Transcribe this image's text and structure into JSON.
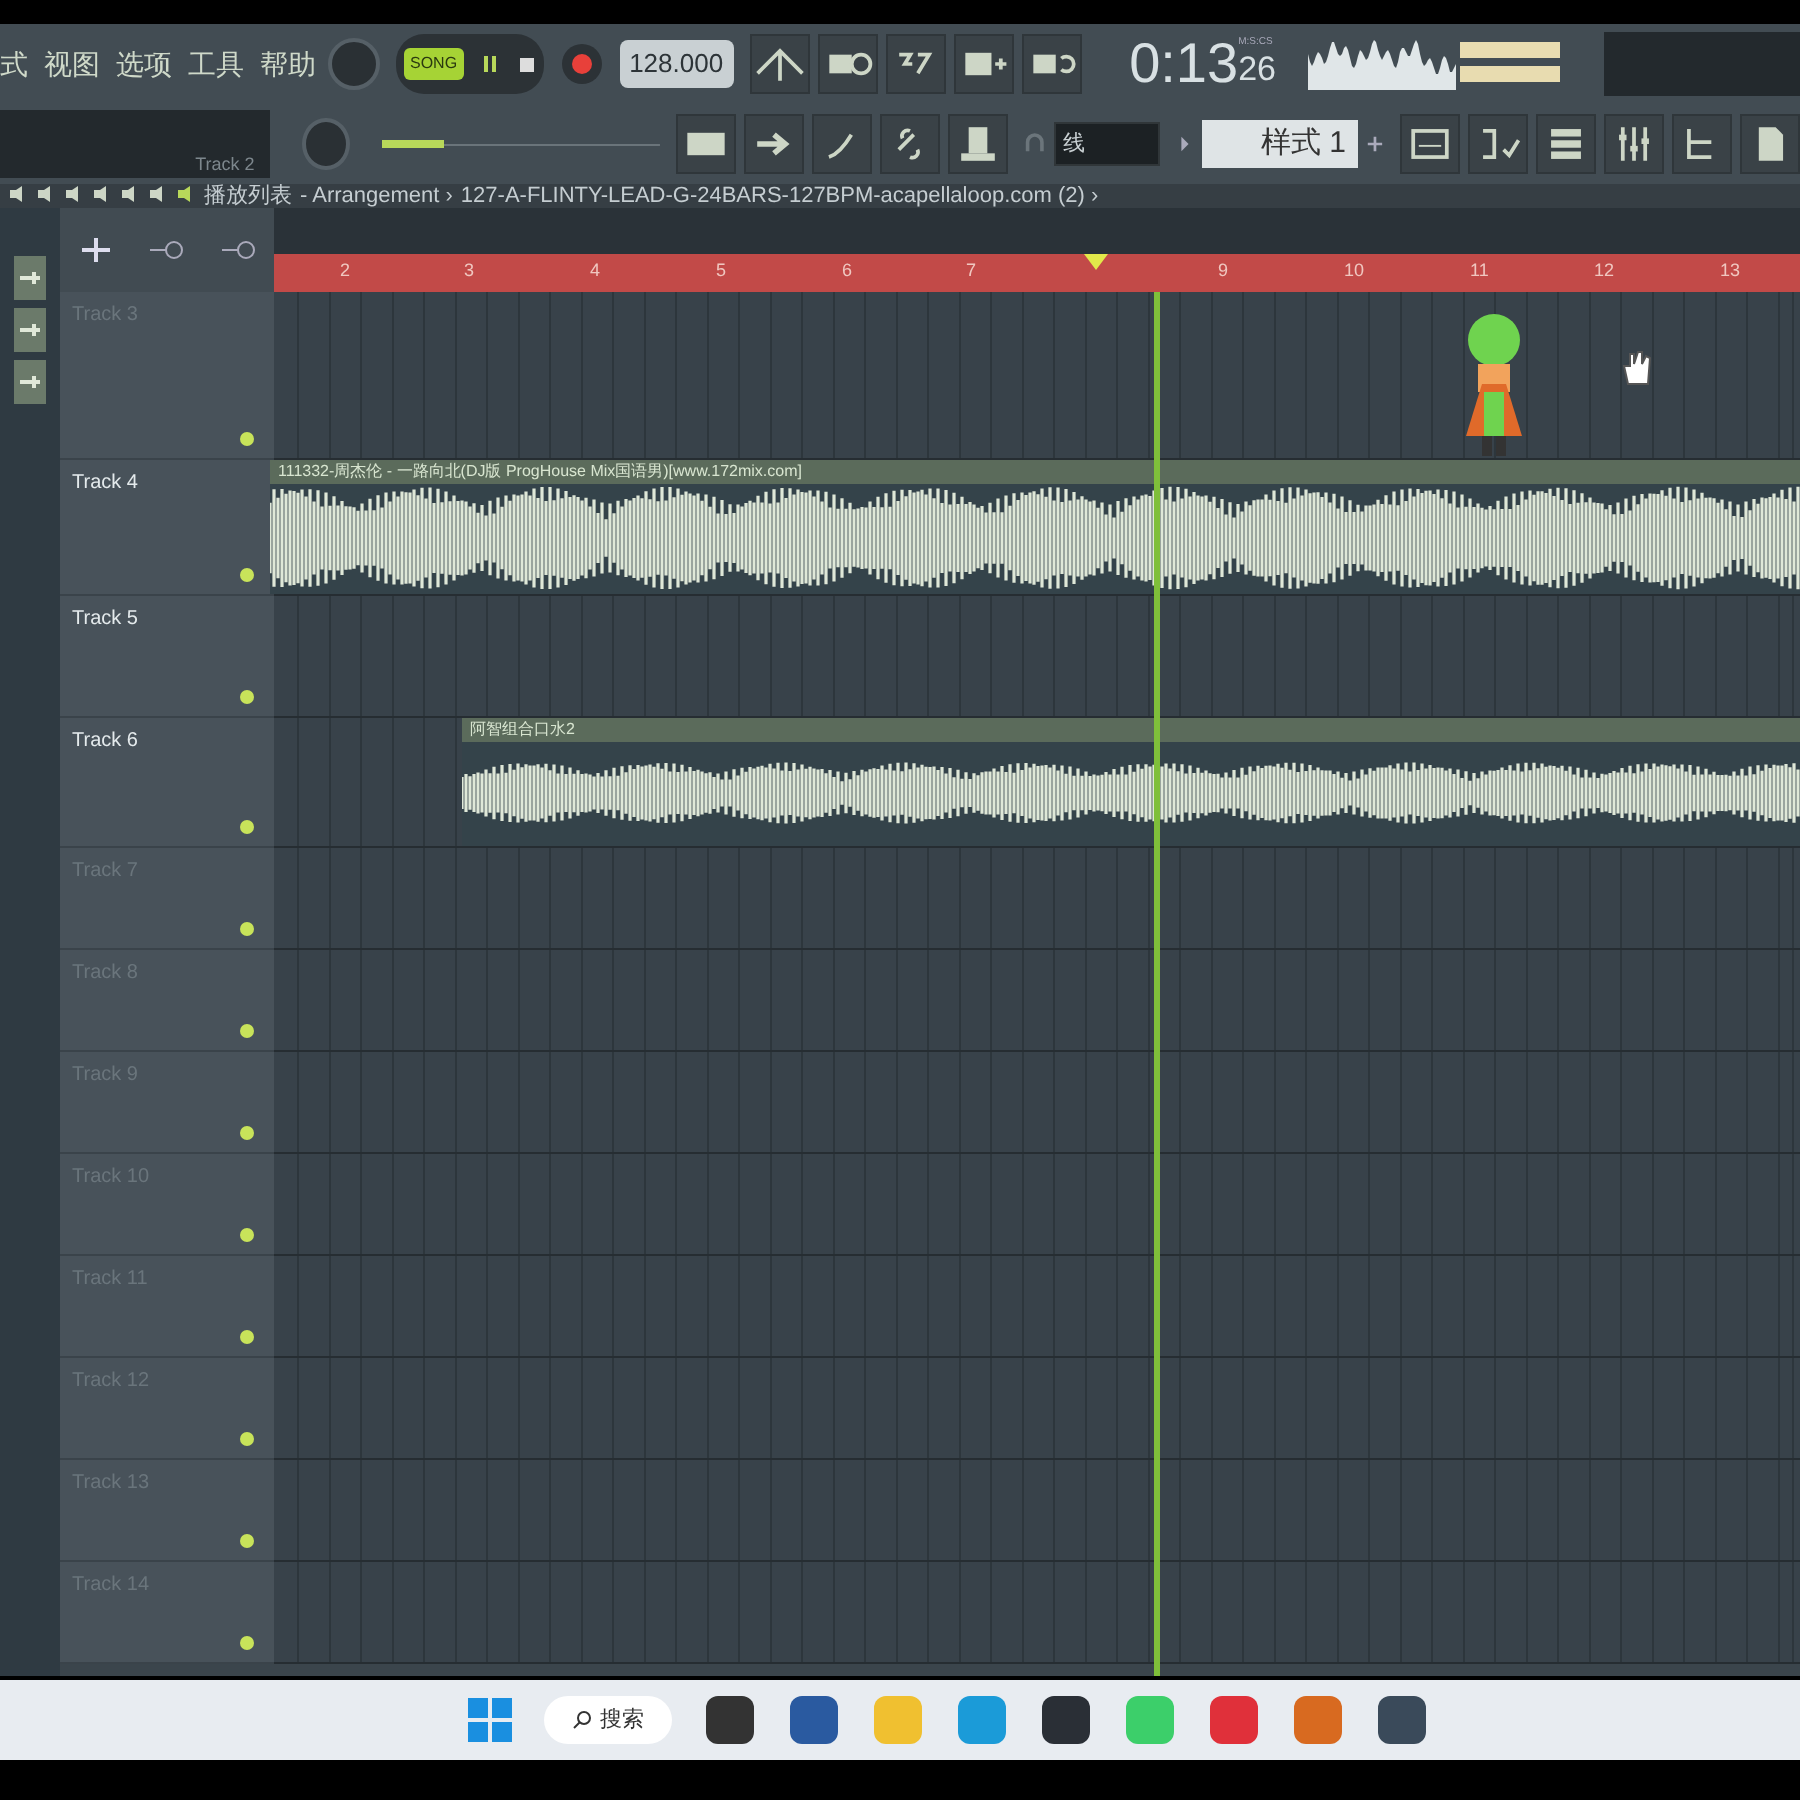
{
  "menu": [
    "式",
    "视图",
    "选项",
    "工具",
    "帮助"
  ],
  "transport": {
    "mode_label": "SONG",
    "song_mode": true,
    "recording": true,
    "tempo": "128.000"
  },
  "hint_panel": {
    "text": "Track 2"
  },
  "master_volume": {
    "level": 0.22
  },
  "time": {
    "value": "0:13",
    "centis": "26",
    "unit": "M:S:CS"
  },
  "snap": {
    "value": "线"
  },
  "pattern": {
    "name": "样式 1"
  },
  "breadcrumb": {
    "window": "播放列表",
    "parts": [
      "- Arrangement ›",
      "127-A-FLINTY-LEAD-G-24BARS-127BPM-acapellaloop.com (2) ›"
    ]
  },
  "ruler": [
    "2",
    "3",
    "4",
    "5",
    "6",
    "7",
    "9",
    "10",
    "11",
    "12",
    "13"
  ],
  "tracks": [
    {
      "name": "Track 3",
      "empty": true
    },
    {
      "name": "Track 4",
      "empty": false,
      "clip": "111332-周杰伦 - 一路向北(DJ版 ProgHouse Mix国语男)[www.172mix.com]"
    },
    {
      "name": "Track 5",
      "empty": false
    },
    {
      "name": "Track 6",
      "empty": false,
      "clip": "阿智组合口水2"
    },
    {
      "name": "Track 7",
      "empty": true
    },
    {
      "name": "Track 8",
      "empty": true
    },
    {
      "name": "Track 9",
      "empty": true
    },
    {
      "name": "Track 10",
      "empty": true
    },
    {
      "name": "Track 11",
      "empty": true
    },
    {
      "name": "Track 12",
      "empty": true
    },
    {
      "name": "Track 13",
      "empty": true
    },
    {
      "name": "Track 14",
      "empty": true
    }
  ],
  "taskbar": {
    "search": "搜索"
  }
}
